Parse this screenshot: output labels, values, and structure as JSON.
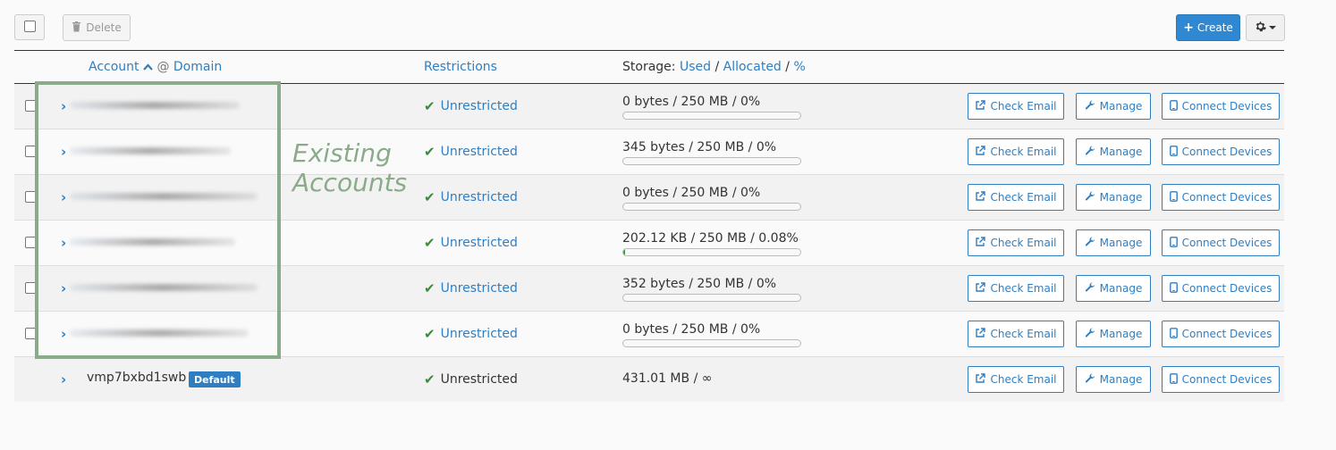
{
  "toolbar": {
    "delete_label": "Delete",
    "create_label": "Create"
  },
  "table": {
    "headers": {
      "account": "Account",
      "at": "@",
      "domain": "Domain",
      "restrictions": "Restrictions",
      "storage_prefix": "Storage:",
      "used": "Used",
      "allocated": "Allocated",
      "percent": "%",
      "sep": "/"
    },
    "rows": [
      {
        "storage": "0 bytes / 250 MB / 0%",
        "fill_fraction": 0.0,
        "restriction": "Unrestricted"
      },
      {
        "storage": "345 bytes / 250 MB / 0%",
        "fill_fraction": 0.0,
        "restriction": "Unrestricted"
      },
      {
        "storage": "0 bytes / 250 MB / 0%",
        "fill_fraction": 0.0,
        "restriction": "Unrestricted"
      },
      {
        "storage": "202.12 KB / 250 MB / 0.08%",
        "fill_fraction": 0.0008,
        "restriction": "Unrestricted"
      },
      {
        "storage": "352 bytes / 250 MB / 0%",
        "fill_fraction": 0.0,
        "restriction": "Unrestricted"
      },
      {
        "storage": "0 bytes / 250 MB / 0%",
        "fill_fraction": 0.0,
        "restriction": "Unrestricted"
      }
    ],
    "default_row": {
      "account": "vmp7bxbd1swb",
      "badge": "Default",
      "restriction": "Unrestricted",
      "storage": "431.01 MB / ∞"
    },
    "actions": {
      "check_email": "Check Email",
      "manage": "Manage",
      "connect_devices": "Connect Devices"
    }
  },
  "annotation": {
    "line1": "Existing",
    "line2": "Accounts"
  },
  "colors": {
    "accent": "#2f7ec1",
    "create_button": "#2f88d1",
    "success": "#3c8a3c",
    "annotation": "#8aab8a"
  }
}
